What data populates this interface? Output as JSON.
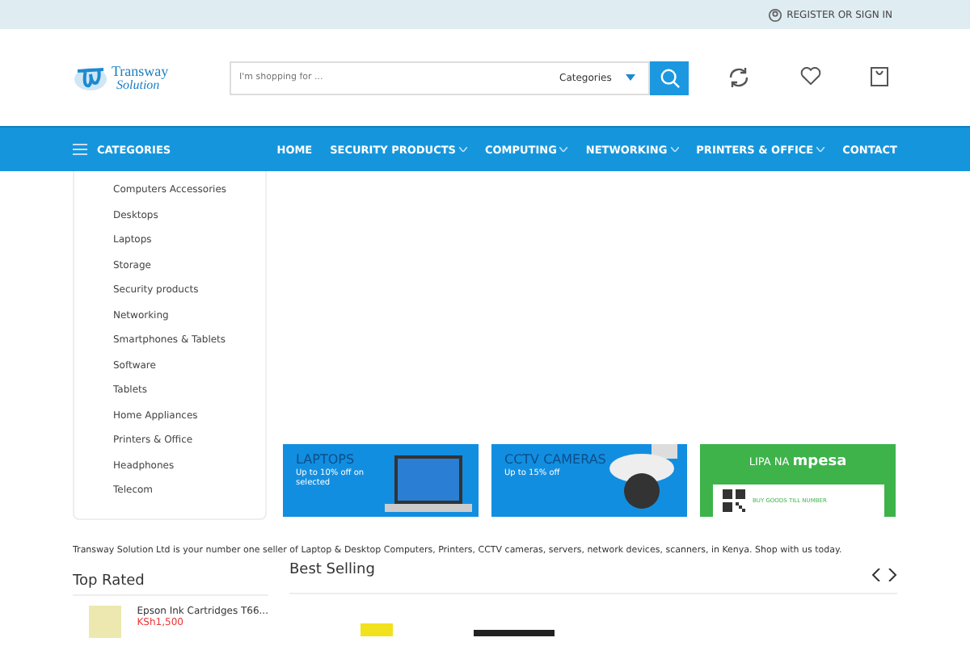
{
  "top_bar": {
    "account_link": "REGISTER OR SIGN IN"
  },
  "header": {
    "logo": {
      "line_1": "Transway",
      "line_2": "Solution"
    },
    "search": {
      "placeholder": "I'm shopping for ...",
      "category_select": "Categories"
    }
  },
  "nav": {
    "categories_button": "CATEGORIES",
    "items": [
      {
        "label": "HOME",
        "dropdown": false
      },
      {
        "label": "SECURITY PRODUCTS",
        "dropdown": true
      },
      {
        "label": "COMPUTING",
        "dropdown": true
      },
      {
        "label": "NETWORKING",
        "dropdown": true
      },
      {
        "label": "PRINTERS & OFFICE",
        "dropdown": true
      },
      {
        "label": "CONTACT",
        "dropdown": false
      }
    ]
  },
  "sidebar": {
    "items": [
      "Computers Accessories",
      "Desktops",
      "Laptops",
      "Storage",
      "Security products",
      "Networking",
      "Smartphones & Tablets",
      "Software",
      "Tablets",
      "Home Appliances",
      "Printers & Office",
      "Headphones",
      "Telecom"
    ]
  },
  "banners": [
    {
      "kind": "laptop",
      "title": "LAPTOPS",
      "subtitle": "Up to 10% off on selected"
    },
    {
      "kind": "camera",
      "title": "CCTV CAMERAS",
      "subtitle": "Up to 15% off"
    },
    {
      "kind": "mpesa",
      "title": "LIPA NA",
      "brand": "mpesa",
      "note": "BUY GOODS TILL NUMBER"
    }
  ],
  "tagline": "Transway Solution Ltd is your number one seller of Laptop & Desktop Computers, Printers, CCTV cameras, servers, network devices, scanners, in Kenya. Shop with us today.",
  "top_rated": {
    "title": "Top Rated",
    "products": [
      {
        "name": "Epson Ink Cartridges T66...",
        "price": "KSh1,500"
      }
    ]
  },
  "best_selling": {
    "title": "Best Selling"
  }
}
